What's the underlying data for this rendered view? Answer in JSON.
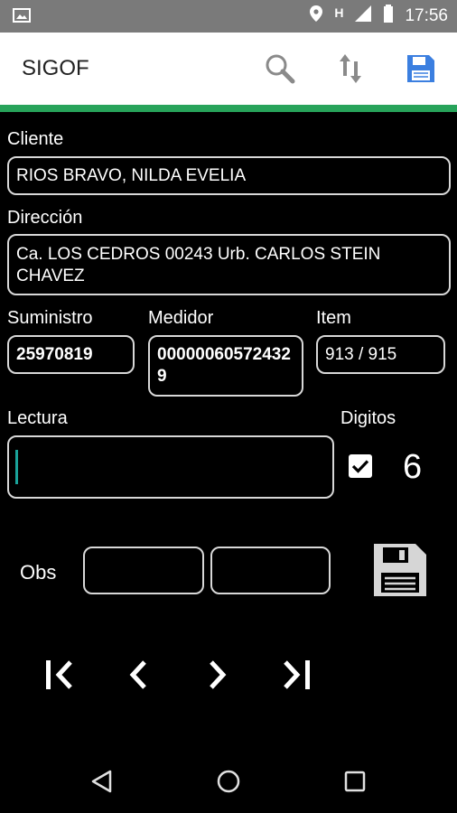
{
  "status_bar": {
    "network_label": "H",
    "time": "17:56"
  },
  "app_bar": {
    "title": "SIGOF"
  },
  "form": {
    "cliente": {
      "label": "Cliente",
      "value": "RIOS BRAVO, NILDA EVELIA"
    },
    "direccion": {
      "label": "Dirección",
      "value": "Ca. LOS CEDROS 00243 Urb. CARLOS STEIN CHAVEZ"
    },
    "suministro": {
      "label": "Suministro",
      "value": "25970819"
    },
    "medidor": {
      "label": "Medidor",
      "value": "000000605724329"
    },
    "item": {
      "label": "Item",
      "value": "913 / 915"
    },
    "lectura": {
      "label": "Lectura",
      "value": ""
    },
    "digitos": {
      "label": "Digitos",
      "checked": true,
      "value": "6"
    },
    "obs": {
      "label": "Obs",
      "value1": "",
      "value2": ""
    }
  },
  "colors": {
    "accent_green": "#27a35a",
    "save_blue": "#3b7fe0",
    "cursor_teal": "#1aa39a"
  }
}
